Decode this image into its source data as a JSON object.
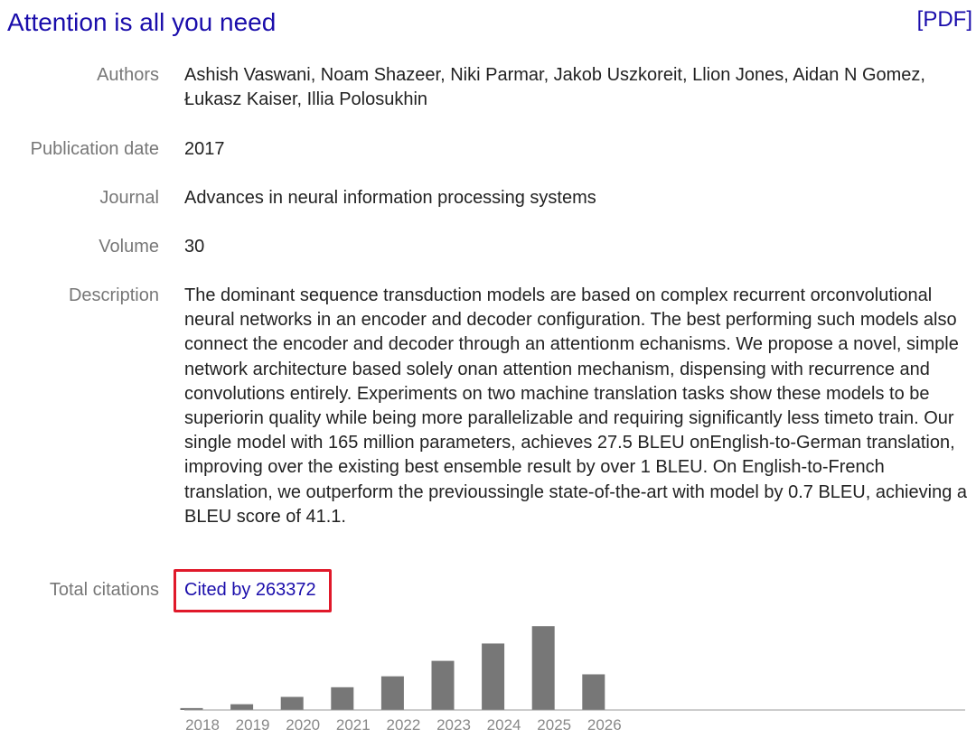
{
  "title": "Attention is all you need",
  "pdf_label": "[PDF]",
  "fields": {
    "authors": {
      "label": "Authors",
      "value": "Ashish Vaswani, Noam Shazeer, Niki Parmar, Jakob Uszkoreit, Llion Jones, Aidan N Gomez, Łukasz Kaiser, Illia Polosukhin"
    },
    "publication_date": {
      "label": "Publication date",
      "value": "2017"
    },
    "journal": {
      "label": "Journal",
      "value": "Advances in neural information processing systems"
    },
    "volume": {
      "label": "Volume",
      "value": "30"
    },
    "description": {
      "label": "Description",
      "value": "The dominant sequence transduction models are based on complex recurrent orconvolutional neural networks in an encoder and decoder configuration. The best performing such models also connect the encoder and decoder through an attentionm echanisms. We propose a novel, simple network architecture based solely onan attention mechanism, dispensing with recurrence and convolutions entirely. Experiments on two machine translation tasks show these models to be superiorin quality while being more parallelizable and requiring significantly less timeto train. Our single model with 165 million parameters, achieves 27.5 BLEU onEnglish-to-German translation, improving over the existing best ensemble result by over 1 BLEU. On English-to-French translation, we outperform the previoussingle state-of-the-art with model by 0.7 BLEU, achieving a BLEU score of 41.1."
    },
    "total_citations": {
      "label": "Total citations",
      "link_text": "Cited by 263372"
    }
  },
  "colors": {
    "link": "#1a0dab",
    "bar": "#777777",
    "highlight_box": "#e0192a"
  },
  "chart_data": {
    "type": "bar",
    "categories": [
      "2018",
      "2019",
      "2020",
      "2021",
      "2022",
      "2023",
      "2024",
      "2025",
      "2026"
    ],
    "values": [
      1000,
      3000,
      6800,
      11800,
      17500,
      25500,
      34500,
      43500,
      18500
    ],
    "ylim": [
      0,
      45000
    ],
    "grid": false,
    "legend": "none"
  }
}
